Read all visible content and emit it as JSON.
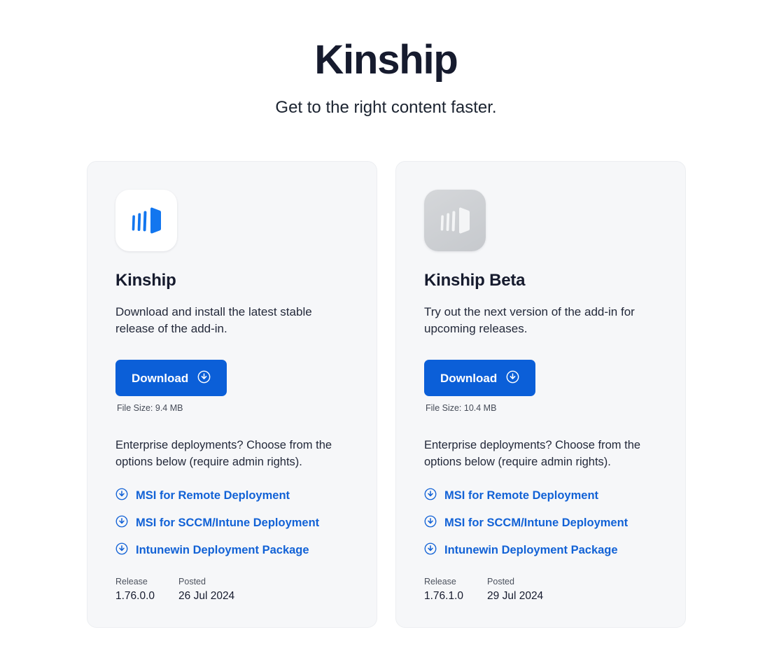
{
  "header": {
    "title": "Kinship",
    "subtitle": "Get to the right content faster."
  },
  "colors": {
    "accent": "#0b5fd8",
    "link": "#1262d6",
    "title": "#161b2e",
    "card_bg": "#f6f7f9",
    "card_border": "#eceef1",
    "page_bg": "#ffffff",
    "logo_blue": "#1276ef",
    "logo_gray": "#c9ccd1"
  },
  "cards": [
    {
      "logo_icon": "kinship-logo-icon",
      "logo_variant": "stable",
      "title": "Kinship",
      "description": "Download and install the latest stable release of the add-in.",
      "download_label": "Download",
      "download_icon": "download-circle-icon",
      "file_size": "File Size: 9.4 MB",
      "enterprise_note": "Enterprise deployments? Choose from the options below (require admin rights).",
      "links": [
        {
          "label": "MSI for Remote Deployment",
          "icon": "download-circle-icon"
        },
        {
          "label": "MSI for SCCM/Intune Deployment",
          "icon": "download-circle-icon"
        },
        {
          "label": "Intunewin Deployment Package",
          "icon": "download-circle-icon"
        }
      ],
      "meta": {
        "release_label": "Release",
        "release_value": "1.76.0.0",
        "posted_label": "Posted",
        "posted_value": "26 Jul 2024"
      }
    },
    {
      "logo_icon": "kinship-beta-logo-icon",
      "logo_variant": "beta",
      "title": "Kinship Beta",
      "description": "Try out the next version of the add-in for upcoming releases.",
      "download_label": "Download",
      "download_icon": "download-circle-icon",
      "file_size": "File Size: 10.4 MB",
      "enterprise_note": "Enterprise deployments? Choose from the options below (require admin rights).",
      "links": [
        {
          "label": "MSI for Remote Deployment",
          "icon": "download-circle-icon"
        },
        {
          "label": "MSI for SCCM/Intune Deployment",
          "icon": "download-circle-icon"
        },
        {
          "label": "Intunewin Deployment Package",
          "icon": "download-circle-icon"
        }
      ],
      "meta": {
        "release_label": "Release",
        "release_value": "1.76.1.0",
        "posted_label": "Posted",
        "posted_value": "29 Jul 2024"
      }
    }
  ]
}
